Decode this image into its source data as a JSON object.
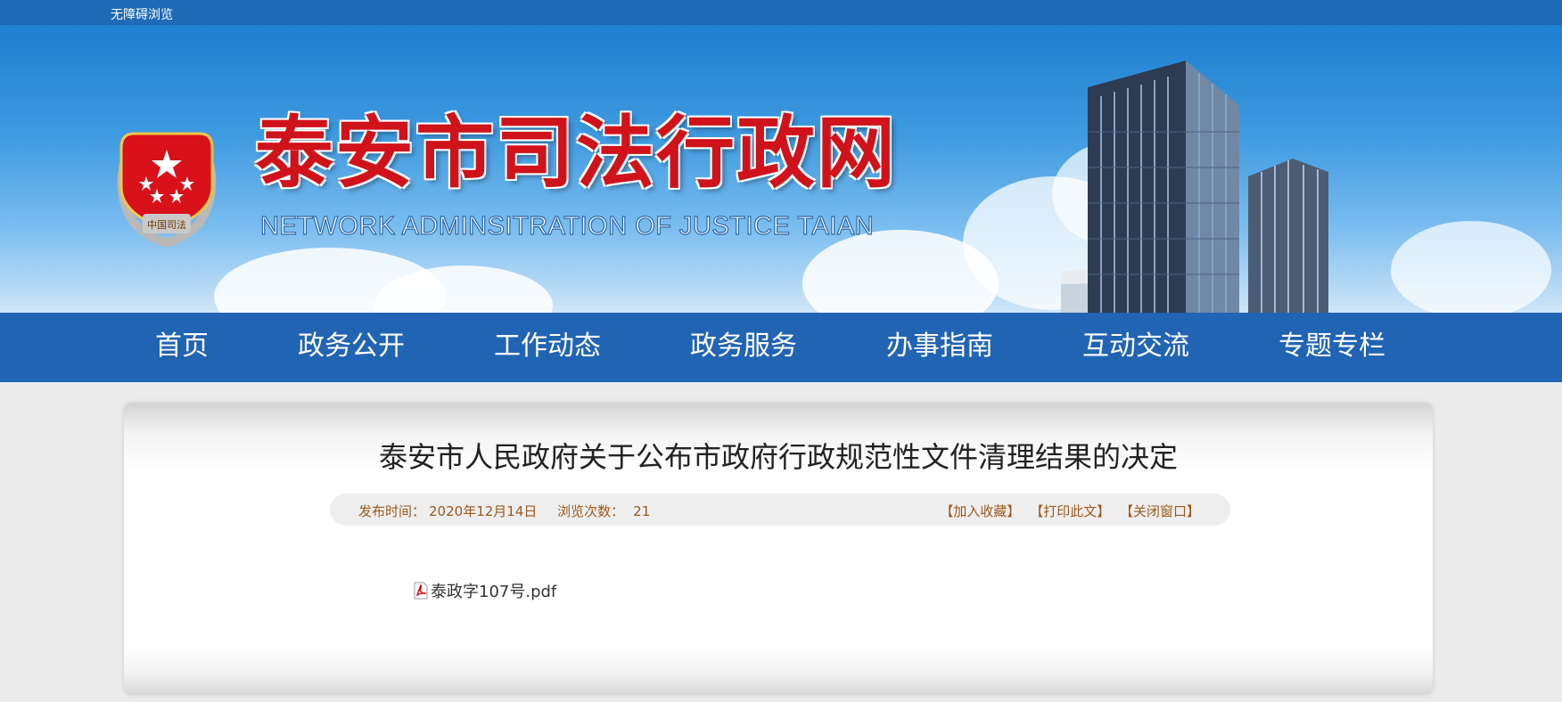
{
  "topbar": {
    "accessibility_link": "无障碍浏览"
  },
  "header": {
    "site_title": "泰安市司法行政网",
    "site_subtitle": "NETWORK ADMINSITRATION OF JUSTICE TAIAN",
    "emblem_label": "中国司法"
  },
  "nav": {
    "items": [
      {
        "label": "首页"
      },
      {
        "label": "政务公开"
      },
      {
        "label": "工作动态"
      },
      {
        "label": "政务服务"
      },
      {
        "label": "办事指南"
      },
      {
        "label": "互动交流"
      },
      {
        "label": "专题专栏"
      }
    ]
  },
  "article": {
    "title": "泰安市人民政府关于公布市政府行政规范性文件清理结果的决定",
    "publish_label": "发布时间：",
    "publish_date": "2020年12月14日",
    "views_label": "浏览次数：",
    "views_count": "21",
    "actions": {
      "favorite": "【加入收藏】",
      "print": "【打印此文】",
      "close": "【关闭窗口】"
    },
    "attachment": {
      "filename": "泰政字107号.pdf",
      "icon": "pdf-icon"
    }
  },
  "colors": {
    "topbar": "#1f6ab4",
    "nav": "#2164b4",
    "title_red": "#d0121b",
    "meta_text": "#9a5a1c",
    "page_bg": "#ebebeb"
  }
}
